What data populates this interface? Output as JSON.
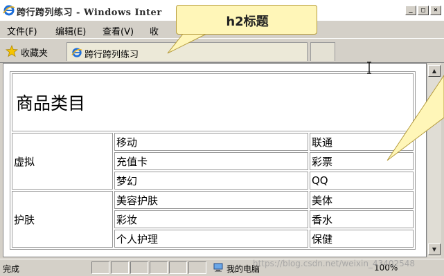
{
  "window": {
    "title": "跨行跨列练习 - Windows Inter",
    "btn_min": "_",
    "btn_max": "□",
    "btn_close": "×"
  },
  "menu": {
    "items": [
      "文件(F)",
      "编辑(E)",
      "查看(V)",
      "收"
    ]
  },
  "favbar": {
    "favorites_label": "收藏夹",
    "tab_label": "跨行跨列练习"
  },
  "page": {
    "heading": "商品类目",
    "rows": [
      {
        "group": "虚拟",
        "items": [
          [
            "移动",
            "联通"
          ],
          [
            "充值卡",
            "彩票"
          ],
          [
            "梦幻",
            "QQ"
          ]
        ]
      },
      {
        "group": "护肤",
        "items": [
          [
            "美容护肤",
            "美体"
          ],
          [
            "彩妆",
            "香水"
          ],
          [
            "个人护理",
            "保健"
          ]
        ]
      }
    ]
  },
  "callout": {
    "text": "h2标题"
  },
  "status": {
    "done": "完成",
    "zone": "我的电脑",
    "zoom": "100%",
    "watermark": "https://blog.csdn.net/weixin_43402548"
  },
  "icons": {
    "ie": "ie-logo-icon",
    "favorites": "star-icon",
    "computer": "computer-icon"
  }
}
